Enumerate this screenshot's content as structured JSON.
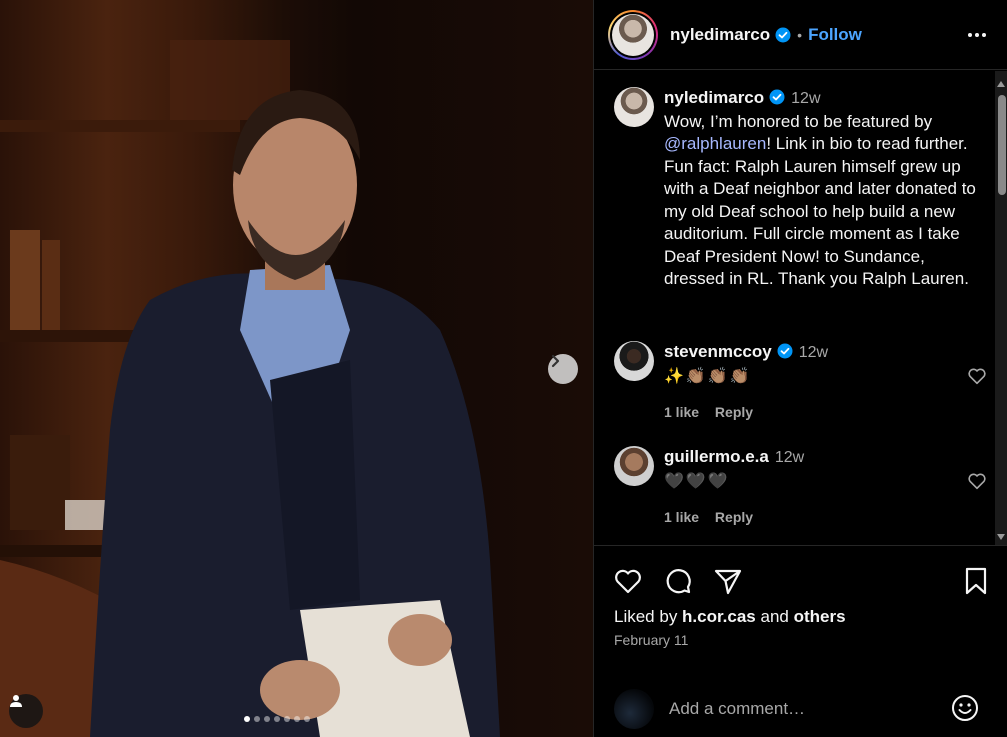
{
  "post": {
    "username": "nyledimarco",
    "follow_label": "Follow",
    "separator": "•"
  },
  "caption": {
    "username": "nyledimarco",
    "time": "12w",
    "text_before": "Wow, I’m honored to be featured by ",
    "mention": "@ralphlauren",
    "text_after": "! Link in bio to read further. Fun fact: Ralph Lauren himself grew up with a Deaf neighbor and later donated to my old Deaf school to help build a new auditorium. Full circle moment as I take Deaf President Now! to Sundance, dressed in RL. Thank you Ralph Lauren."
  },
  "comments": [
    {
      "username": "stevenmccoy",
      "time": "12w",
      "text": "✨👏🏽👏🏽👏🏽",
      "likes": "1 like",
      "reply": "Reply",
      "verified": true
    },
    {
      "username": "guillermo.e.a",
      "time": "12w",
      "text": "🖤🖤🖤",
      "likes": "1 like",
      "reply": "Reply",
      "verified": false
    }
  ],
  "footer": {
    "liked_prefix": "Liked by ",
    "liked_user": "h.cor.cas",
    "liked_and": " and ",
    "liked_others": "others",
    "date": "February 11",
    "comment_placeholder": "Add a comment…"
  },
  "carousel": {
    "total_slides": 7,
    "active_index": 0
  },
  "icons": {
    "verified": "verified-badge-icon",
    "heart": "heart-icon",
    "comment": "comment-icon",
    "share": "share-icon",
    "save": "bookmark-icon",
    "more": "more-options-icon",
    "next": "chevron-right-icon",
    "tag": "user-tag-icon",
    "emoji": "emoji-icon"
  },
  "colors": {
    "accent_blue": "#4ca5ff",
    "verified_blue": "#0095f6",
    "mention": "#a7b8ff",
    "muted": "#a8a8a8"
  }
}
